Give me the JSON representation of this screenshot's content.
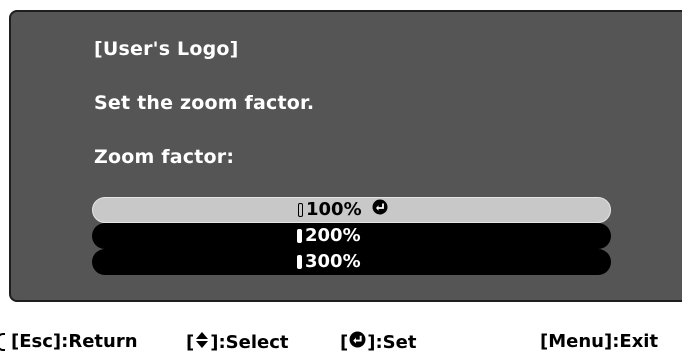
{
  "dialog": {
    "title": "[User's Logo]",
    "description": "Set the zoom factor.",
    "label": "Zoom factor:"
  },
  "options": [
    {
      "label": "100%",
      "selected": true
    },
    {
      "label": "200%",
      "selected": false
    },
    {
      "label": "300%",
      "selected": false
    }
  ],
  "footer": {
    "esc_key": "[Esc]",
    "esc_action": ":Return",
    "select_open": "[",
    "select_close": "]",
    "select_action": ":Select",
    "set_open": "[",
    "set_close": "]",
    "set_action": ":Set",
    "menu_key": "[Menu]",
    "menu_action": ":Exit"
  },
  "colors": {
    "dialog_bg": "#555555",
    "option_bg": "#000000",
    "selected_bg": "#c8c8c8",
    "text_light": "#ffffff"
  },
  "icons": {
    "enter": "enter-icon",
    "updown": "up-down-arrows-icon"
  }
}
